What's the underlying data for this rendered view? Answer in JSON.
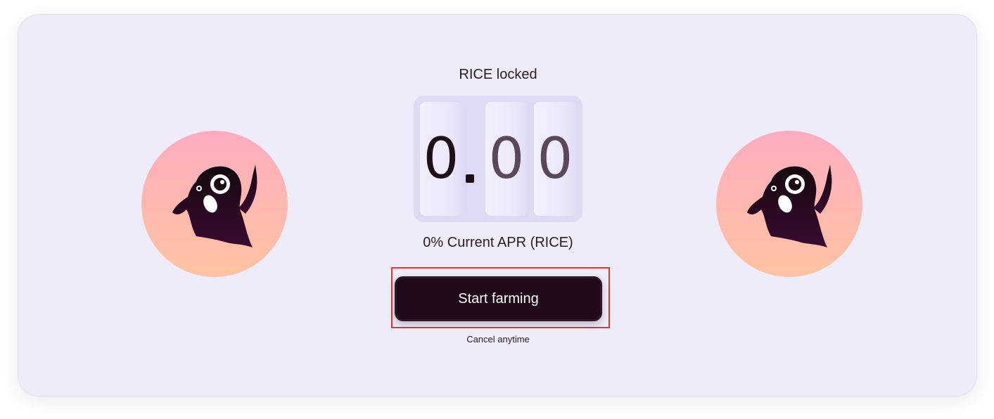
{
  "farming": {
    "locked_label": "RICE locked",
    "counter": {
      "integer_digit": "0",
      "decimal_digit_1": "0",
      "decimal_digit_2": "0"
    },
    "apr_label": "0% Current APR (RICE)",
    "start_button_label": "Start farming",
    "cancel_note": "Cancel anytime"
  },
  "mascots": [
    {
      "icon": "ghost-mascot-icon"
    },
    {
      "icon": "ghost-mascot-icon"
    }
  ],
  "colors": {
    "card_background": "#efecfa",
    "button_background": "#20091a",
    "highlight": "#e53232",
    "mascot_gradient_top": "#ffacc0",
    "mascot_gradient_bottom": "#ffc3a1"
  }
}
